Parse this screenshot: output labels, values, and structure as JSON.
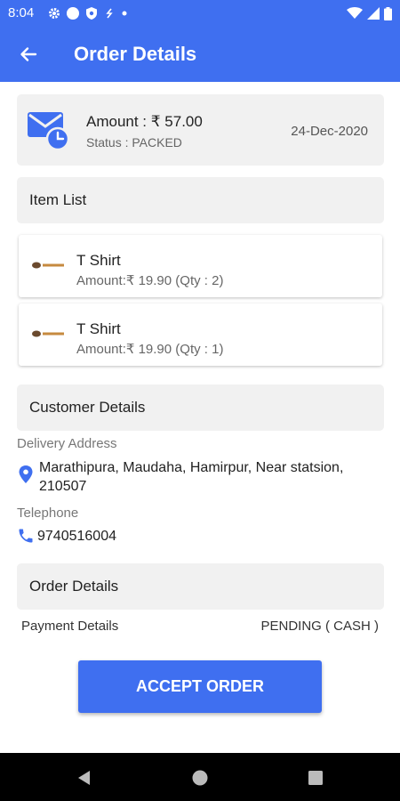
{
  "status_bar": {
    "time": "8:04",
    "icons": [
      "gear-icon",
      "circle-icon",
      "shield-icon",
      "sync-icon",
      "dot-icon",
      "wifi-icon",
      "signal-icon",
      "battery-icon"
    ]
  },
  "app_bar": {
    "title": "Order Details",
    "back_icon": "arrow-back-icon"
  },
  "summary": {
    "amount": "Amount : ₹ 57.00",
    "status": "Status :  PACKED",
    "date": "24-Dec-2020",
    "icon": "mail-clock-icon"
  },
  "item_list": {
    "header": "Item List",
    "items": [
      {
        "name": "T Shirt",
        "amount": "Amount:₹ 19.90 (Qty : 2)"
      },
      {
        "name": "T Shirt",
        "amount": "Amount:₹ 19.90 (Qty : 1)"
      }
    ]
  },
  "customer": {
    "header": "Customer Details",
    "delivery_label": "Delivery Address",
    "address": "Marathipura, Maudaha, Hamirpur, Near statsion, 210507",
    "telephone_label": "Telephone",
    "phone": "9740516004"
  },
  "order": {
    "header": "Order Details",
    "payment_label": "Payment Details",
    "payment_value": "PENDING ( CASH )"
  },
  "actions": {
    "accept": "ACCEPT ORDER"
  },
  "colors": {
    "primary": "#3f6ff0",
    "card_bg": "#f1f1f1"
  }
}
